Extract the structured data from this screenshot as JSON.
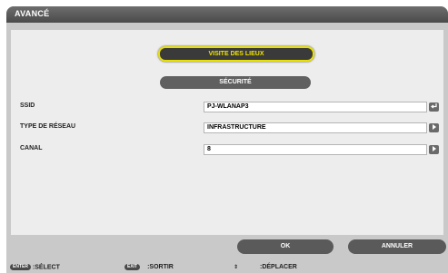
{
  "window": {
    "title": "AVANCÉ"
  },
  "tabs": [
    {
      "label": "VISITE DES LIEUX",
      "active": true
    },
    {
      "label": "SÉCURITÉ",
      "active": false
    }
  ],
  "fields": {
    "ssid": {
      "label": "SSID",
      "value": "PJ-WLANAP3",
      "icon": "enter-icon"
    },
    "network_type": {
      "label": "TYPE DE RÉSEAU",
      "value": "INFRASTRUCTURE",
      "icon": "arrow-right-icon"
    },
    "channel": {
      "label": "CANAL",
      "value": "8",
      "icon": "arrow-right-icon"
    }
  },
  "buttons": {
    "ok": "OK",
    "cancel": "ANNULER"
  },
  "hints": {
    "enter_key": "ENTER",
    "enter_label": ":SÉLECT",
    "exit_key": "EXIT",
    "exit_label": ":SORTIR",
    "move_label": ":DÉPLACER"
  },
  "colors": {
    "active_border": "#e8e000",
    "active_text": "#f2e600",
    "pill": "#606060"
  }
}
